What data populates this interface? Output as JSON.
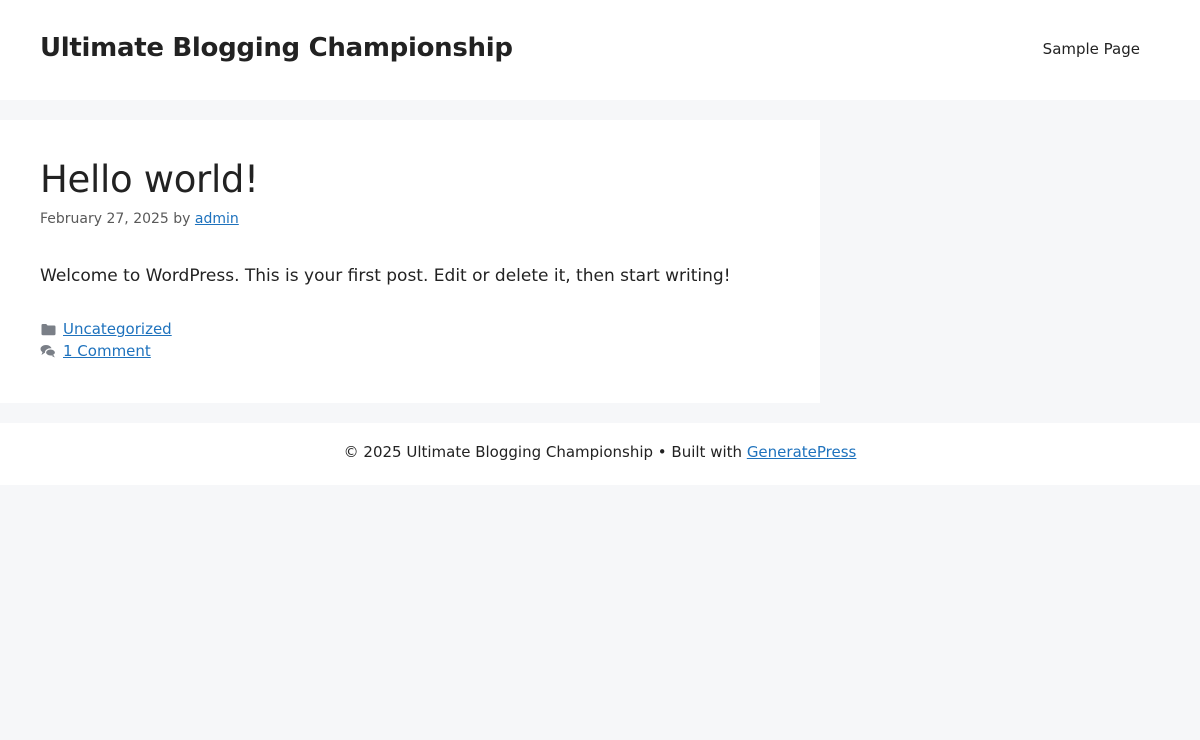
{
  "header": {
    "site_title": "Ultimate Blogging Championship",
    "nav": [
      {
        "label": "Sample Page"
      }
    ]
  },
  "post": {
    "title": "Hello world!",
    "date": "February 27, 2025",
    "by": "by",
    "author": "admin",
    "content": "Welcome to WordPress. This is your first post. Edit or delete it, then start writing!",
    "category_icon": "folder-icon",
    "category": "Uncategorized",
    "comments_icon": "comments-icon",
    "comments": "1 Comment"
  },
  "footer": {
    "copyright": "© 2025 Ultimate Blogging Championship • Built with",
    "link": "GeneratePress"
  },
  "colors": {
    "background": "#f6f7f9",
    "surface": "#ffffff",
    "text": "#222222",
    "link": "#1e72bd",
    "meta": "#595959"
  }
}
